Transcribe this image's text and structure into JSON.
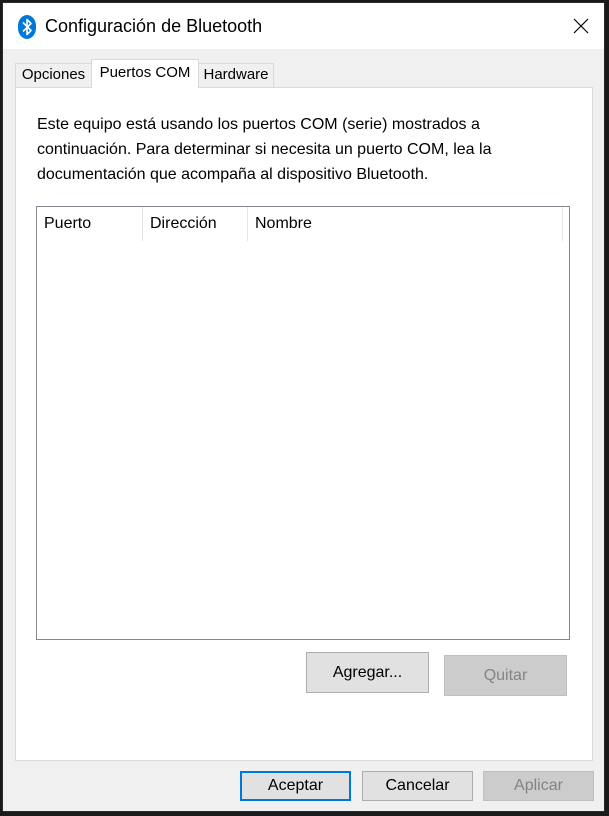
{
  "window": {
    "title": "Configuración de Bluetooth",
    "icon": "bluetooth-icon",
    "accent": "#0078d7"
  },
  "tabs": [
    {
      "label": "Opciones",
      "active": false
    },
    {
      "label": "Puertos COM",
      "active": true
    },
    {
      "label": "Hardware",
      "active": false
    }
  ],
  "panel": {
    "description": "Este equipo está usando los puertos COM (serie) mostrados a continuación. Para determinar si necesita un puerto COM, lea la documentación que acompaña al dispositivo Bluetooth.",
    "columns": [
      "Puerto",
      "Dirección",
      "Nombre"
    ],
    "rows": [],
    "add_button": "Agregar...",
    "remove_button": "Quitar"
  },
  "footer": {
    "ok_button": "Aceptar",
    "cancel_button": "Cancelar",
    "apply_button": "Aplicar"
  }
}
